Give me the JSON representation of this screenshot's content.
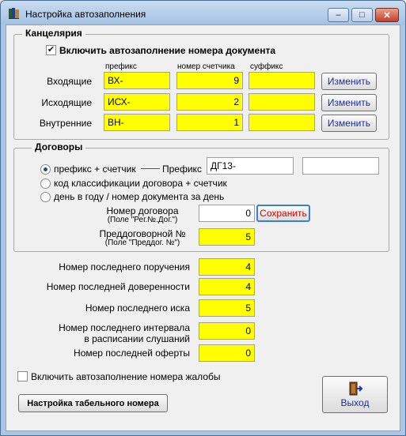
{
  "window": {
    "title": "Настройка автозаполнения",
    "controls": {
      "minimize": "–",
      "maximize": "□",
      "close": "✕"
    }
  },
  "chancellery": {
    "title": "Канцелярия",
    "autofill_label": "Включить автозаполнение номера документа",
    "autofill_checked": true,
    "col_prefix": "префикс",
    "col_counter": "номер счетчика",
    "col_suffix": "суффикс",
    "rows": [
      {
        "label": "Входящие",
        "prefix": "ВХ-",
        "counter": "9",
        "suffix": "",
        "button": "Изменить"
      },
      {
        "label": "Исходящие",
        "prefix": "ИСХ-",
        "counter": "2",
        "suffix": "",
        "button": "Изменить"
      },
      {
        "label": "Внутренние",
        "prefix": "ВН-",
        "counter": "1",
        "suffix": "",
        "button": "Изменить"
      }
    ]
  },
  "contracts": {
    "title": "Договоры",
    "options": [
      "префикс + счетчик",
      "код классификации  договора + счетчик",
      "день в году / номер документа за день"
    ],
    "selected_option": 0,
    "prefix_label": "Префикс",
    "prefix_value": "ДГ13-",
    "extra_value": "",
    "contract_number_label": "Номер договора",
    "contract_number_sub": "(Поле \"Рег.№.Дог.\")",
    "contract_number_value": "0",
    "save_button": "Сохранить",
    "pre_contract_label": "Преддоговорной №",
    "pre_contract_sub": "(Поле \"Преддог. №\")",
    "pre_contract_value": "5"
  },
  "counters": [
    {
      "label": "Номер последнего поручения",
      "value": "4"
    },
    {
      "label": "Номер последней доверенности",
      "value": "4"
    },
    {
      "label": "Номер последнего иска",
      "value": "5"
    },
    {
      "label": "Номер последнего интервала\nв расписании слушаний",
      "value": "0"
    },
    {
      "label": "Номер последней оферты",
      "value": "0"
    }
  ],
  "complaint_autofill_label": "Включить автозаполнение номера жалобы",
  "complaint_autofill_checked": false,
  "timesheet_button": "Настройка табельного номера",
  "exit_button": "Выход",
  "colors": {
    "highlight_field": "#ffff00",
    "button_text": "#1a2c9c",
    "save_text": "#d00000"
  }
}
